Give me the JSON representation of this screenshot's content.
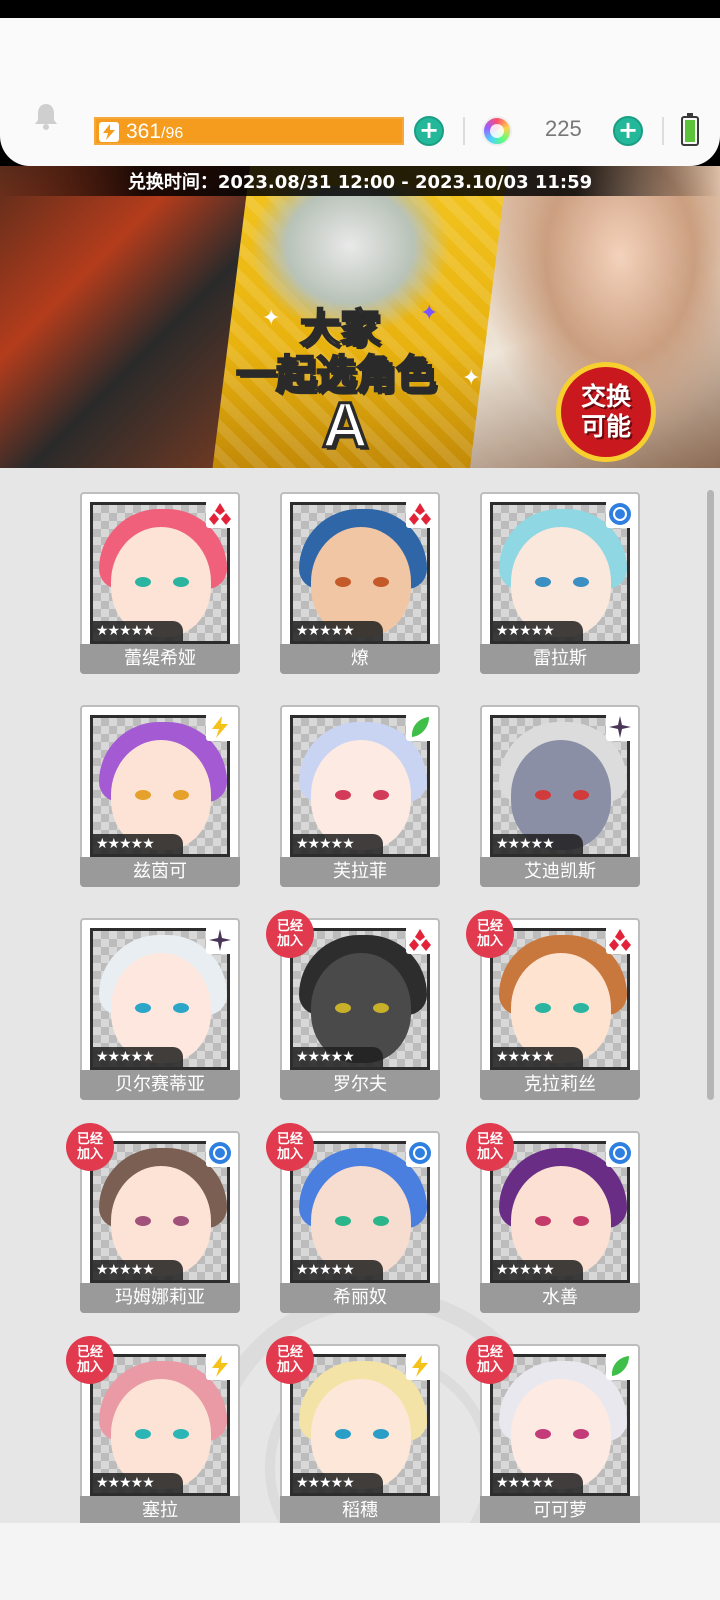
{
  "header": {
    "stamina_current": "361",
    "stamina_max": "/96",
    "gems": "225"
  },
  "banner": {
    "exchange_time": "兑换时间：2023.08/31 12:00 - 2023.10/03 11:59",
    "title_line1": "大家",
    "title_line2": "一起选角色",
    "title_letter": "A",
    "badge_line1": "交换",
    "badge_line2": "可能"
  },
  "joined_label_line1": "已经",
  "joined_label_line2": "加入",
  "stars": "★★★★★",
  "characters": [
    {
      "name": "蕾缇希娅",
      "attribute": "diamond-icon",
      "joined": false,
      "hair": "#f0607a",
      "skin": "#fde3d6",
      "eye": "#2bb5a0"
    },
    {
      "name": "燎",
      "attribute": "diamond-icon",
      "joined": false,
      "hair": "#2f66a8",
      "skin": "#f1c6a5",
      "eye": "#c45a2a"
    },
    {
      "name": "雷拉斯",
      "attribute": "water-orb-icon",
      "joined": false,
      "hair": "#8fd7e3",
      "skin": "#fbe8dc",
      "eye": "#3b8fc2"
    },
    {
      "name": "兹茵可",
      "attribute": "lightning-icon",
      "joined": false,
      "hair": "#a45ad2",
      "skin": "#fde3d6",
      "eye": "#e6a12b"
    },
    {
      "name": "芙拉菲",
      "attribute": "leaf-icon",
      "joined": false,
      "hair": "#c9d3f2",
      "skin": "#fdeae2",
      "eye": "#d23b5a"
    },
    {
      "name": "艾迪凯斯",
      "attribute": "dark-star-icon",
      "joined": false,
      "hair": "#dcdcdc",
      "skin": "#8a8fa6",
      "eye": "#d23b3b"
    },
    {
      "name": "贝尔赛蒂亚",
      "attribute": "dark-star-icon",
      "joined": false,
      "hair": "#e8eef2",
      "skin": "#fde7de",
      "eye": "#2ba6c8"
    },
    {
      "name": "罗尔夫",
      "attribute": "diamond-icon",
      "joined": true,
      "hair": "#2d2d2d",
      "skin": "#4a4a4a",
      "eye": "#c8b02b"
    },
    {
      "name": "克拉莉丝",
      "attribute": "diamond-icon",
      "joined": true,
      "hair": "#c9783d",
      "skin": "#fde3d0",
      "eye": "#2bb5a0"
    },
    {
      "name": "玛姆娜莉亚",
      "attribute": "water-orb-icon",
      "joined": true,
      "hair": "#7b5f52",
      "skin": "#fde3d6",
      "eye": "#a0527a"
    },
    {
      "name": "希丽奴",
      "attribute": "water-orb-icon",
      "joined": true,
      "hair": "#4a7fe0",
      "skin": "#f7dcd0",
      "eye": "#2bb58a"
    },
    {
      "name": "水善",
      "attribute": "water-orb-icon",
      "joined": true,
      "hair": "#6a2d86",
      "skin": "#fbe0d3",
      "eye": "#c43b6a"
    },
    {
      "name": "塞拉",
      "attribute": "lightning-icon",
      "joined": true,
      "hair": "#e99aa4",
      "skin": "#fde3d6",
      "eye": "#2bb5b5"
    },
    {
      "name": "稻穗",
      "attribute": "lightning-icon",
      "joined": true,
      "hair": "#f4e3a6",
      "skin": "#fde7d8",
      "eye": "#2b9ec8"
    },
    {
      "name": "可可萝",
      "attribute": "leaf-icon",
      "joined": true,
      "hair": "#e8e8ee",
      "skin": "#fdeae2",
      "eye": "#c43b7a"
    }
  ],
  "colors": {
    "accent_green": "#23b89a",
    "stamina_orange": "#f59b1e",
    "joined_red": "#e13a4e",
    "diamond_red": "#e2233a",
    "water_blue": "#2f7fe0",
    "lightning_yellow": "#f5c21a",
    "leaf_green": "#3fbf4a",
    "dark_purple": "#4a3457"
  }
}
